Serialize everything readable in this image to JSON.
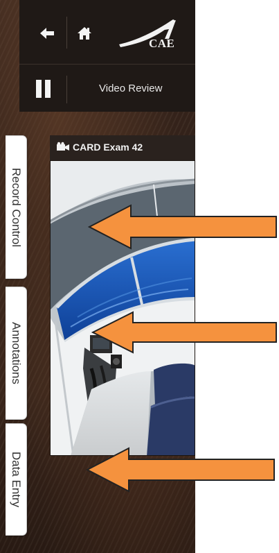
{
  "header": {
    "logo_text": "CAE",
    "back_icon": "arrow-left-icon",
    "home_icon": "home-icon"
  },
  "subheader": {
    "pause_icon": "pause-icon",
    "title": "Video Review"
  },
  "side_tabs": [
    {
      "label": "Record Control"
    },
    {
      "label": "Annotations"
    },
    {
      "label": "Data Entry"
    }
  ],
  "video": {
    "icon": "camera-icon",
    "title": "CARD Exam 42"
  },
  "annotations": {
    "arrow_color": "#f5923e",
    "arrow_outline": "#222222",
    "arrows": [
      "arrow-left-icon",
      "arrow-left-icon",
      "arrow-left-icon"
    ]
  },
  "colors": {
    "toolbar_bg": "#1f1916",
    "window_blue": "#1b5fc4"
  }
}
